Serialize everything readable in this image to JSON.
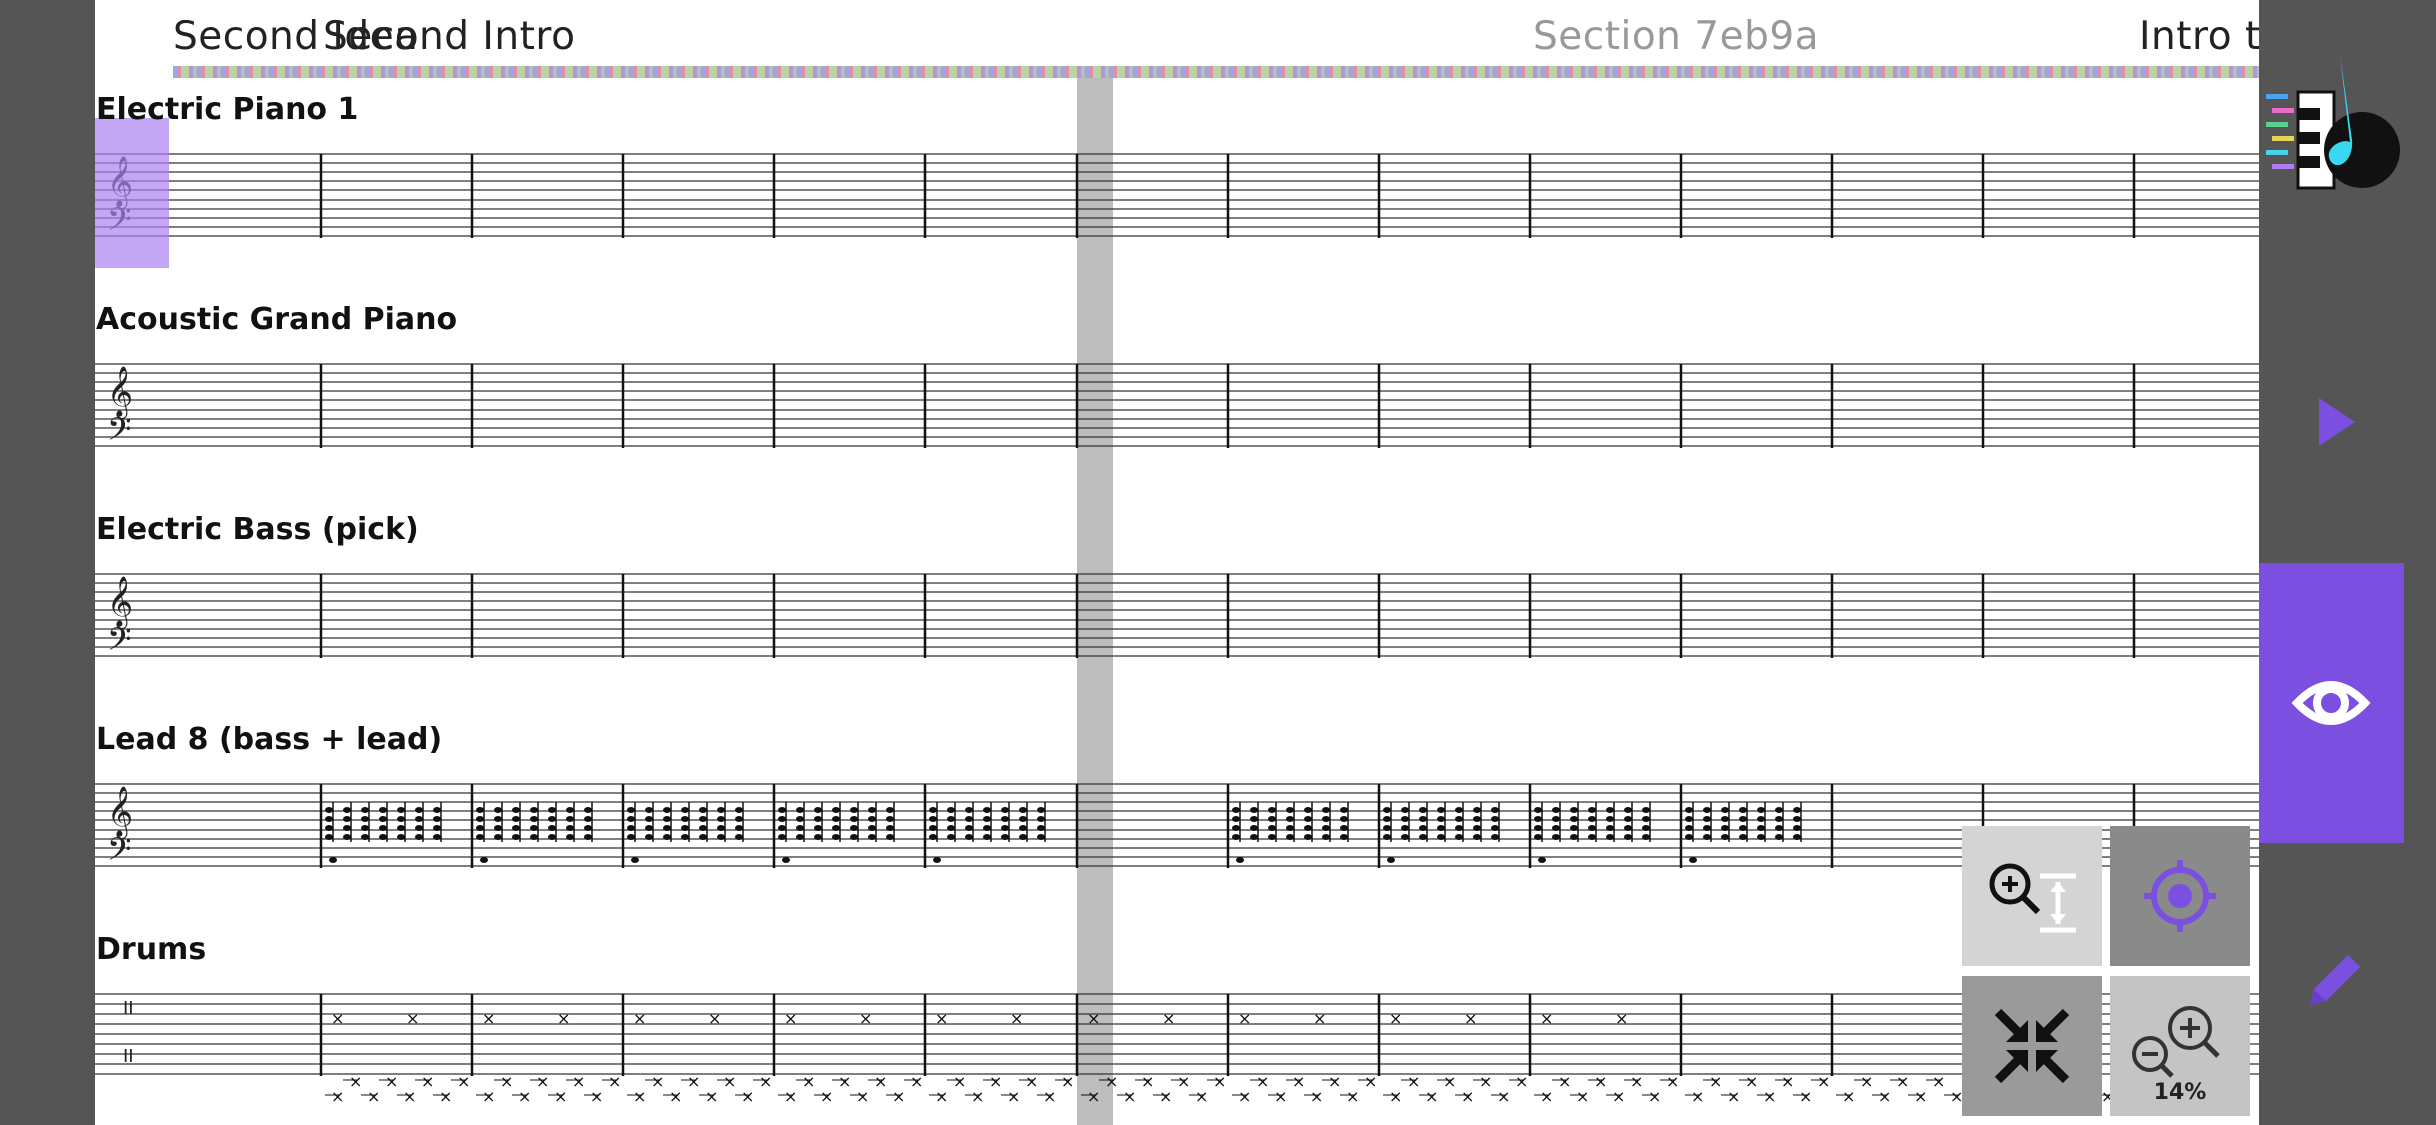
{
  "sections": [
    {
      "label": "Second Idea"
    },
    {
      "label": "Second Intro"
    },
    {
      "label": "Section 7eb9a"
    },
    {
      "label": "Intro t"
    }
  ],
  "tracks": [
    {
      "name": "Electric Piano 1"
    },
    {
      "name": "Acoustic Grand Piano"
    },
    {
      "name": "Electric Bass (pick)"
    },
    {
      "name": "Lead 8 (bass + lead)"
    },
    {
      "name": "Drums"
    }
  ],
  "toolbar": {
    "logo": "app-logo",
    "play": "play-icon",
    "view": "eye-icon",
    "edit": "pencil-icon"
  },
  "zoom": {
    "level": "14%"
  },
  "colors": {
    "accent": "#7b4fe0",
    "playhead": "#bdbdbd",
    "selection": "#b58ef0"
  }
}
